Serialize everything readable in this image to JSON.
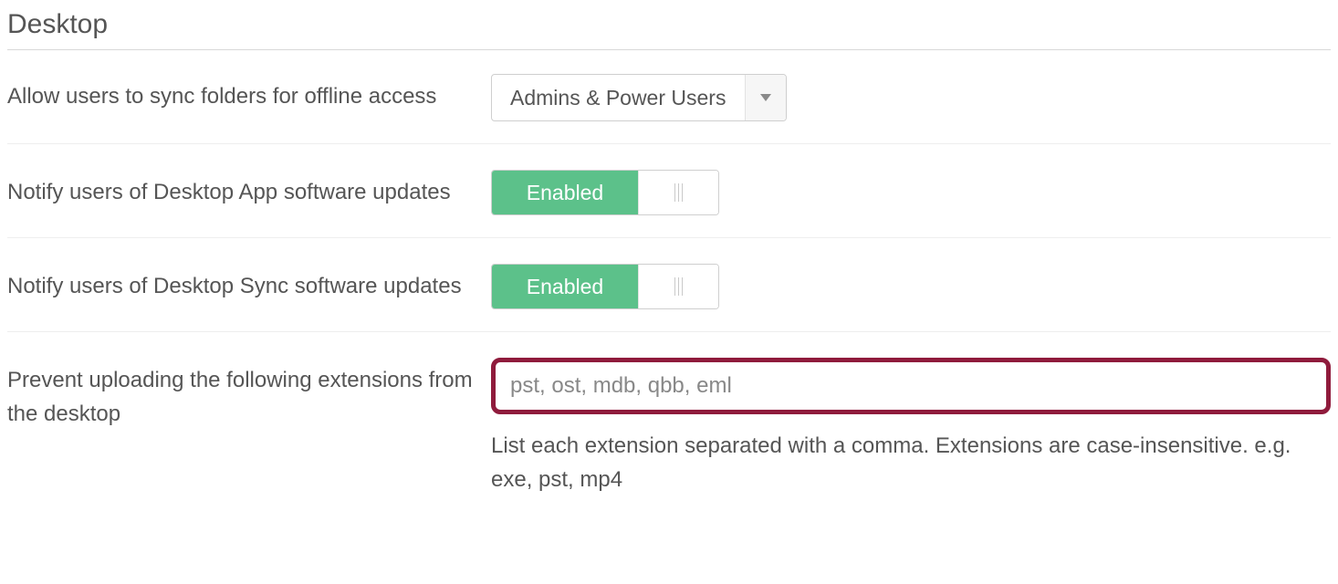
{
  "section": {
    "title": "Desktop"
  },
  "rows": {
    "sync": {
      "label": "Allow users to sync folders for offline access",
      "select_value": "Admins & Power Users"
    },
    "notify_app": {
      "label": "Notify users of Desktop App software updates",
      "toggle_label": "Enabled"
    },
    "notify_sync": {
      "label": "Notify users of Desktop Sync software updates",
      "toggle_label": "Enabled"
    },
    "prevent_ext": {
      "label": "Prevent uploading the following extensions from the desktop",
      "input_value": "pst, ost, mdb, qbb, eml",
      "helper": "List each extension separated with a comma. Extensions are case-insensitive. e.g. exe, pst, mp4"
    }
  }
}
